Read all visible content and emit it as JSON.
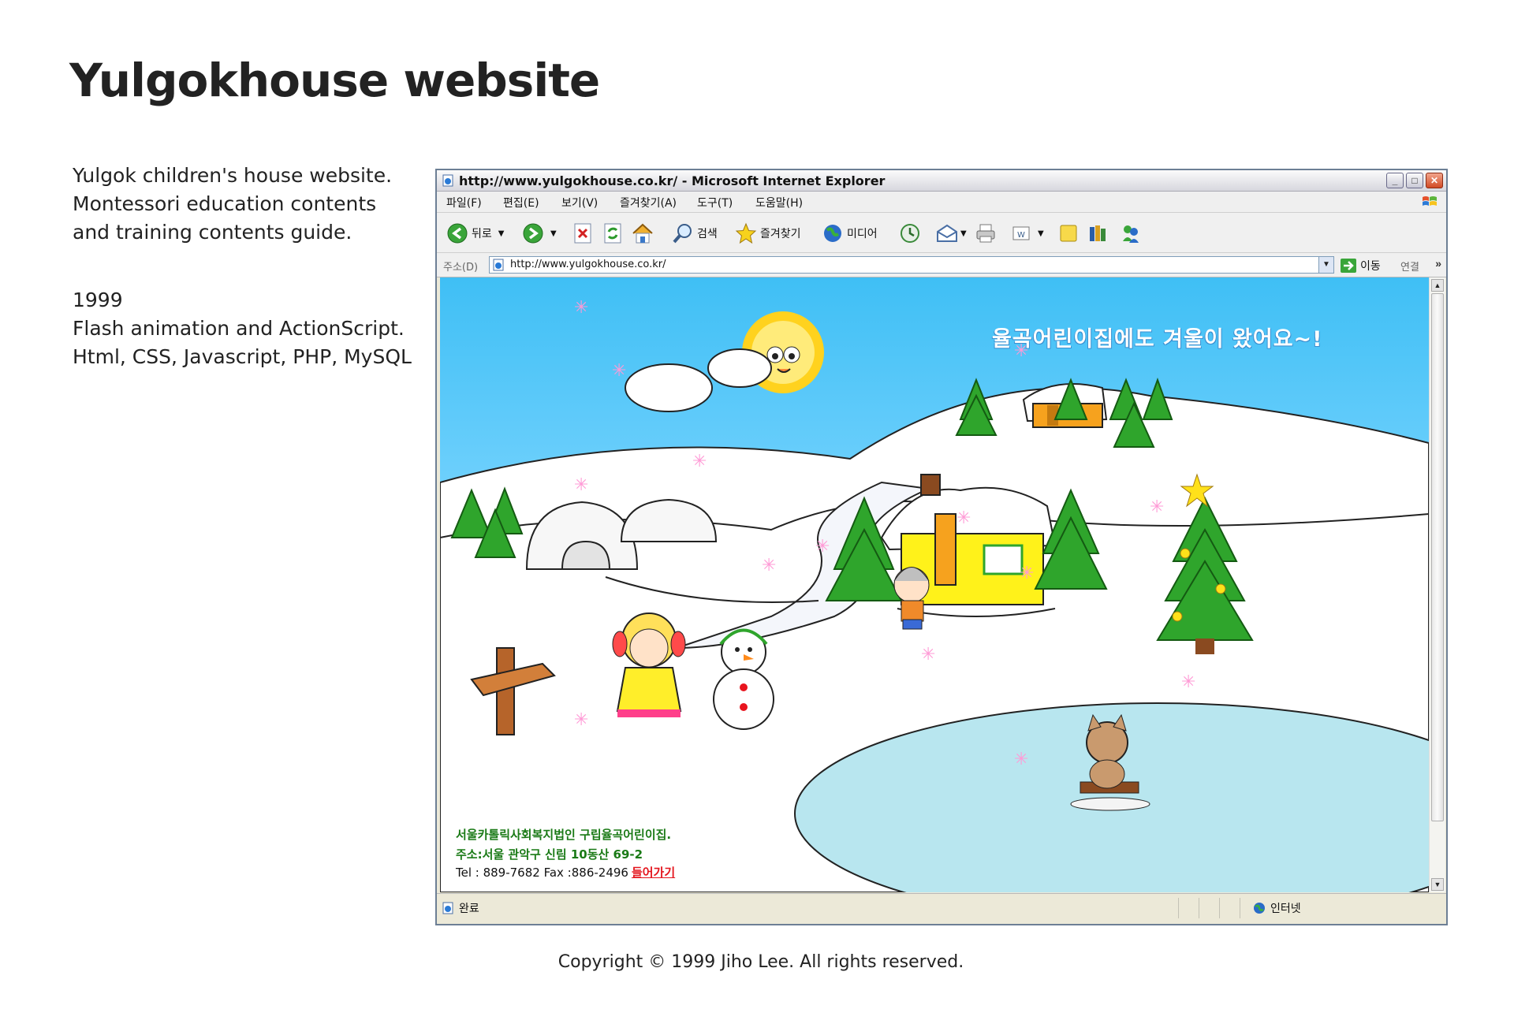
{
  "page": {
    "title": "Yulgokhouse website",
    "description_lines": [
      "Yulgok children's house website.",
      "Montessori education contents",
      "and training contents guide."
    ],
    "meta_lines": [
      "1999",
      "Flash animation and ActionScript.",
      "Html, CSS, Javascript, PHP, MySQL"
    ],
    "copyright": "Copyright © 1999 Jiho Lee. All rights reserved."
  },
  "browser": {
    "window_title": "http://www.yulgokhouse.co.kr/ - Microsoft Internet Explorer",
    "menu": [
      "파일(F)",
      "편집(E)",
      "보기(V)",
      "즐겨찾기(A)",
      "도구(T)",
      "도움말(H)"
    ],
    "toolbar": {
      "back": "뒤로",
      "search": "검색",
      "favorites": "즐겨찾기",
      "media": "미디어"
    },
    "address": {
      "label": "주소(D)",
      "url": "http://www.yulgokhouse.co.kr/",
      "go": "이동",
      "links": "연결"
    },
    "status": {
      "left": "완료",
      "zone": "인터넷"
    }
  },
  "site": {
    "banner": "율곡어린이집에도 겨울이 왔어요~!",
    "address_line1": "서울카톨릭사회복지법인 구립율곡어린이집.",
    "address_line2": "주소:서울 관악구 신림 10동산 69-2",
    "contact": "Tel : 889-7682 Fax :886-2496",
    "enter": "들어가기"
  },
  "colors": {
    "sky": "#4cc3f7",
    "snow": "#ffffff",
    "pond": "#b8e6ef",
    "tree": "#2fa52c",
    "info_text": "#1a7a16",
    "enter_link": "#e4161e"
  }
}
